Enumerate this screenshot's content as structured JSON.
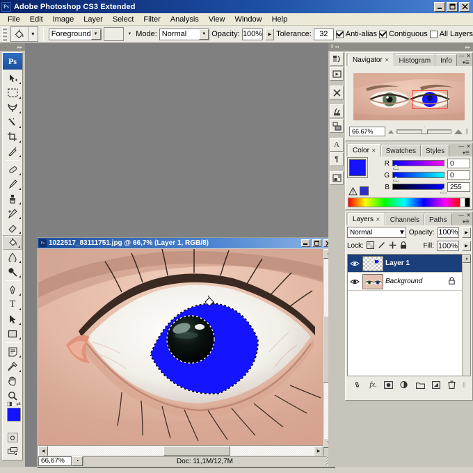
{
  "app": {
    "title": "Adobe Photoshop CS3 Extended",
    "logo": "Ps",
    "window_controls": {
      "minimize": "_",
      "maximize": "□",
      "close": "✕"
    }
  },
  "menubar": {
    "items": [
      "File",
      "Edit",
      "Image",
      "Layer",
      "Select",
      "Filter",
      "Analysis",
      "View",
      "Window",
      "Help"
    ]
  },
  "options_bar": {
    "tool_icon": "paint-bucket-icon",
    "fill_source": "Foreground",
    "mode_label": "Mode:",
    "mode_value": "Normal",
    "opacity_label": "Opacity:",
    "opacity_value": "100%",
    "tolerance_label": "Tolerance:",
    "tolerance_value": "32",
    "antialias_label": "Anti-alias",
    "antialias_checked": true,
    "contiguous_label": "Contiguous",
    "contiguous_checked": true,
    "alllayers_label": "All Layers",
    "alllayers_checked": false
  },
  "toolbar": {
    "logo": "Ps",
    "tools": [
      {
        "name": "move-tool",
        "glyph": "✥",
        "group": 1,
        "active": false
      },
      {
        "name": "rectangular-marquee-tool",
        "glyph": "▭",
        "group": 1,
        "active": false
      },
      {
        "name": "lasso-tool",
        "glyph": "⌇",
        "group": 1,
        "active": false
      },
      {
        "name": "magic-wand-tool",
        "glyph": "✳",
        "group": 1,
        "active": false
      },
      {
        "name": "crop-tool",
        "glyph": "⌗",
        "group": 1,
        "active": false
      },
      {
        "name": "slice-tool",
        "glyph": "✂",
        "group": 1,
        "active": false
      },
      {
        "name": "healing-brush-tool",
        "glyph": "⟋",
        "group": 2,
        "active": false
      },
      {
        "name": "brush-tool",
        "glyph": "🖌",
        "group": 2,
        "active": false
      },
      {
        "name": "clone-stamp-tool",
        "glyph": "⚑",
        "group": 2,
        "active": false
      },
      {
        "name": "history-brush-tool",
        "glyph": "↯",
        "group": 2,
        "active": false
      },
      {
        "name": "eraser-tool",
        "glyph": "▰",
        "group": 2,
        "active": false
      },
      {
        "name": "paint-bucket-tool",
        "glyph": "◗",
        "group": 2,
        "active": true
      },
      {
        "name": "gradient-blur-tool",
        "glyph": "💧",
        "group": 2,
        "active": false
      },
      {
        "name": "dodge-tool",
        "glyph": "◉",
        "group": 2,
        "active": false
      },
      {
        "name": "pen-tool",
        "glyph": "✒",
        "group": 3,
        "active": false
      },
      {
        "name": "horizontal-type-tool",
        "glyph": "T",
        "group": 3,
        "active": false
      },
      {
        "name": "path-selection-tool",
        "glyph": "➤",
        "group": 3,
        "active": false
      },
      {
        "name": "rectangle-shape-tool",
        "glyph": "▢",
        "group": 3,
        "active": false
      },
      {
        "name": "notes-tool",
        "glyph": "🗒",
        "group": 4,
        "active": false
      },
      {
        "name": "eyedropper-tool",
        "glyph": "⚲",
        "group": 4,
        "active": false
      },
      {
        "name": "hand-tool",
        "glyph": "✋",
        "group": 4,
        "active": false
      },
      {
        "name": "zoom-tool",
        "glyph": "🔍",
        "group": 4,
        "active": false
      }
    ],
    "foreground_color": "#1414ff",
    "background_color": "#000000",
    "quick_mask_label": "quick-mask-mode",
    "screen_mode_label": "screen-mode"
  },
  "document": {
    "title": "1022517_83111751.jpg @ 66,7% (Layer 1, RGB/8)",
    "zoom": "66,67%",
    "doc_info": "Doc: 11,1M/12,7M",
    "window_controls": {
      "minimize": "_",
      "maximize": "□",
      "close": "✕"
    }
  },
  "navigator_panel": {
    "tabs": [
      {
        "label": "Navigator",
        "active": true,
        "closable": true
      },
      {
        "label": "Histogram",
        "active": false,
        "closable": false
      },
      {
        "label": "Info",
        "active": false,
        "closable": false
      }
    ],
    "zoom_value": "66.67%"
  },
  "color_panel": {
    "tabs": [
      {
        "label": "Color",
        "active": true,
        "closable": true
      },
      {
        "label": "Swatches",
        "active": false,
        "closable": false
      },
      {
        "label": "Styles",
        "active": false,
        "closable": false
      }
    ],
    "foreground_color": "#1414ff",
    "background_color": "#000000",
    "channels": [
      {
        "label": "R",
        "value": "0",
        "knob_pct": 2
      },
      {
        "label": "G",
        "value": "0",
        "knob_pct": 2
      },
      {
        "label": "B",
        "value": "255",
        "knob_pct": 95
      }
    ],
    "out_of_gamut_warning": "gamut-warning-icon"
  },
  "layers_panel": {
    "tabs": [
      {
        "label": "Layers",
        "active": true,
        "closable": true
      },
      {
        "label": "Channels",
        "active": false,
        "closable": false
      },
      {
        "label": "Paths",
        "active": false,
        "closable": false
      }
    ],
    "blend_mode": "Normal",
    "opacity_label": "Opacity:",
    "opacity_value": "100%",
    "lock_label": "Lock:",
    "fill_label": "Fill:",
    "fill_value": "100%",
    "lock_icons": [
      "lock-transparent-pixels-icon",
      "lock-image-pixels-icon",
      "lock-position-icon",
      "lock-all-icon"
    ],
    "layers": [
      {
        "name": "Layer 1",
        "visible": true,
        "selected": true,
        "locked": false,
        "thumb": "checker"
      },
      {
        "name": "Background",
        "visible": true,
        "selected": false,
        "locked": true,
        "thumb": "eyes-photo"
      }
    ],
    "footer_buttons": [
      {
        "name": "link-layers-button",
        "glyph": "∞"
      },
      {
        "name": "layer-style-button",
        "glyph": "fx"
      },
      {
        "name": "layer-mask-button",
        "glyph": "▣"
      },
      {
        "name": "adjustment-layer-button",
        "glyph": "◑"
      },
      {
        "name": "new-group-button",
        "glyph": "▭"
      },
      {
        "name": "new-layer-button",
        "glyph": "▤"
      },
      {
        "name": "delete-layer-button",
        "glyph": "🗑"
      }
    ]
  },
  "icon_rail": {
    "buttons": [
      {
        "name": "history-panel-icon",
        "glyph": "↺"
      },
      {
        "name": "actions-panel-icon",
        "glyph": "▶"
      },
      {
        "name": "tool-presets-panel-icon",
        "glyph": "✂"
      },
      {
        "name": "brushes-panel-icon",
        "glyph": "❦"
      },
      {
        "name": "clone-source-panel-icon",
        "glyph": "⎙"
      },
      {
        "name": "character-panel-icon",
        "glyph": "A"
      },
      {
        "name": "paragraph-panel-icon",
        "glyph": "¶"
      },
      {
        "name": "layer-comps-panel-icon",
        "glyph": "▤"
      }
    ]
  },
  "colors": {
    "selection_blue": "#1414ff",
    "accent_blue": "#1d4f9c",
    "workspace_gray": "#808080",
    "panel_bg": "#eceae2",
    "chrome_bg": "#c6c4bb",
    "marquee_red": "#ff2b2b"
  }
}
